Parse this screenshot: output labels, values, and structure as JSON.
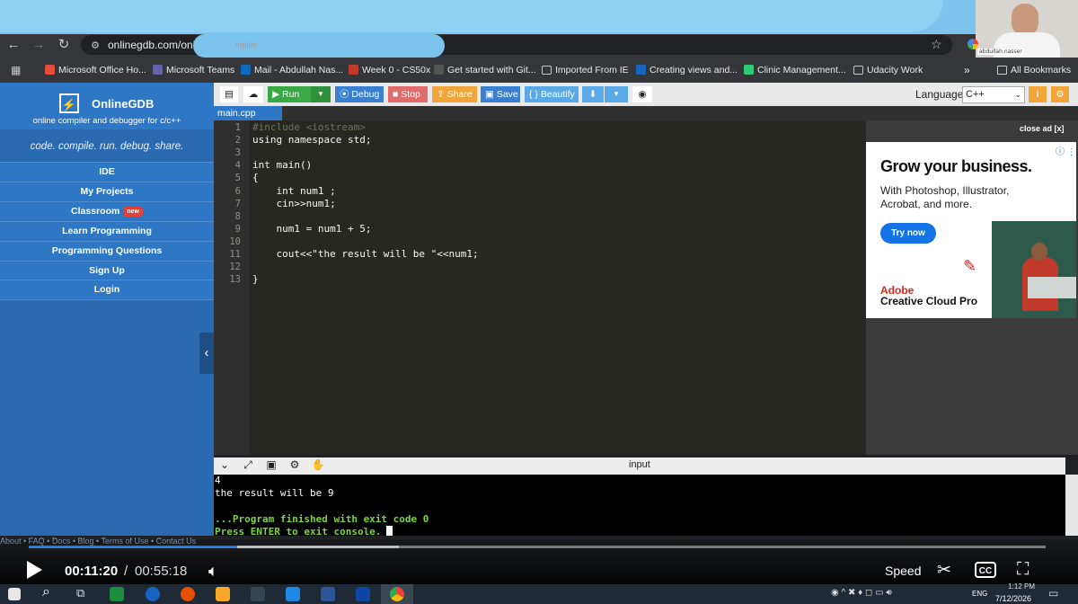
{
  "browser": {
    "url": "onlinegdb.com/onli",
    "url_tail": "mpiler",
    "webcam_label": "abdullah.nasser",
    "bookmarks": [
      {
        "label": "Microsoft Office Ho...",
        "color": "#e74c3c"
      },
      {
        "label": "Microsoft Teams",
        "color": "#6264a7"
      },
      {
        "label": "Mail - Abdullah Nas...",
        "color": "#0f6cbd"
      },
      {
        "label": "Week 0 - CS50x",
        "color": "#c0392b"
      },
      {
        "label": "Get started with Git...",
        "color": "#555"
      },
      {
        "label": "Imported From IE",
        "color": "folder"
      },
      {
        "label": "Creating views and...",
        "color": "#1565c0"
      },
      {
        "label": "Clinic Management...",
        "color": "#2ecc71"
      },
      {
        "label": "Udacity Work",
        "color": "folder"
      }
    ],
    "all_bookmarks": "All Bookmarks",
    "overflow": "»"
  },
  "sidebar": {
    "brand": "OnlineGDB",
    "subtitle": "online compiler and debugger for c/c++",
    "tagline": "code. compile. run. debug. share.",
    "items": [
      {
        "label": "IDE"
      },
      {
        "label": "My Projects"
      },
      {
        "label": "Classroom",
        "badge": "new"
      },
      {
        "label": "Learn Programming"
      },
      {
        "label": "Programming Questions"
      },
      {
        "label": "Sign Up"
      },
      {
        "label": "Login"
      }
    ],
    "footer": "About • FAQ • Docs • Blog • Terms of Use • Contact Us"
  },
  "toolbar": {
    "run": "Run",
    "debug": "Debug",
    "stop": "Stop",
    "share": "Share",
    "save": "Save",
    "beautify": "{ } Beautify",
    "language_label": "Language",
    "language_value": "C++"
  },
  "editor": {
    "file_tab": "main.cpp",
    "lines": [
      {
        "n": "1",
        "code": "#include <iostream>"
      },
      {
        "n": "2",
        "code": "using namespace std;"
      },
      {
        "n": "3",
        "code": ""
      },
      {
        "n": "4",
        "code": "int main()"
      },
      {
        "n": "5",
        "code": "{"
      },
      {
        "n": "6",
        "code": "    int num1 ;"
      },
      {
        "n": "7",
        "code": "    cin>>num1;"
      },
      {
        "n": "8",
        "code": ""
      },
      {
        "n": "9",
        "code": "    num1 = num1 + 5;"
      },
      {
        "n": "10",
        "code": ""
      },
      {
        "n": "11",
        "code": "    cout<<\"the result will be \"<<num1;"
      },
      {
        "n": "12",
        "code": ""
      },
      {
        "n": "13",
        "code": "}"
      }
    ]
  },
  "ad": {
    "close": "close ad [x]",
    "title": "Grow your business.",
    "body": "With Photoshop, Illustrator, Acrobat, and more.",
    "button": "Try now",
    "brand": "Adobe",
    "product": "Creative Cloud Pro"
  },
  "console": {
    "title": "input",
    "lines": [
      {
        "text": "4",
        "color": "#ffffff"
      },
      {
        "text": "the result will be 9",
        "color": "#ffffff"
      },
      {
        "text": "",
        "color": "#ffffff"
      },
      {
        "text": "...Program finished with exit code 0",
        "color": "#7cd63c"
      },
      {
        "text": "Press ENTER to exit console.",
        "color": "#7cd63c"
      }
    ]
  },
  "player": {
    "current_time": "00:11:20",
    "separator": "/",
    "total_time": "00:55:18",
    "speed_label": "Speed",
    "cc_label": "CC",
    "played_fraction": 0.205
  },
  "taskbar": {
    "lang": "ENG",
    "time": "1:12 PM",
    "date": "7/12/2026"
  }
}
